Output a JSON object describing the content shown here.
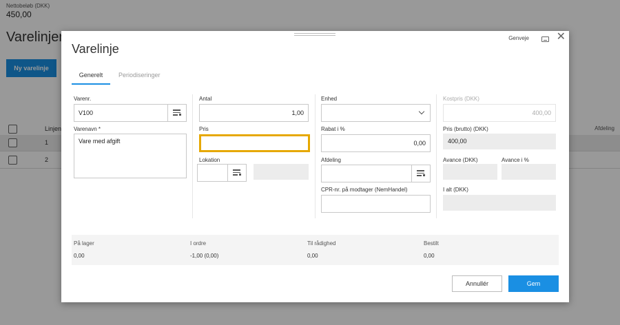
{
  "background": {
    "net_amount_label": "Nettobeløb (DKK)",
    "net_amount_value": "450,00",
    "page_title": "Varelinjer",
    "new_line_button": "Ny varelinje",
    "table": {
      "columns": [
        "Linjen",
        "Afdeling"
      ],
      "rows": [
        {
          "line": "1"
        },
        {
          "line": "2"
        }
      ]
    }
  },
  "modal": {
    "title": "Varelinje",
    "shortcuts_label": "Genveje",
    "tabs": [
      {
        "label": "Generelt",
        "active": true
      },
      {
        "label": "Periodiseringer",
        "active": false
      }
    ],
    "fields": {
      "item_no": {
        "label": "Varenr.",
        "value": "V100"
      },
      "item_name": {
        "label": "Varenavn *",
        "value": "Vare med afgift"
      },
      "quantity": {
        "label": "Antal",
        "value": "1,00"
      },
      "price": {
        "label": "Pris",
        "value": ""
      },
      "location": {
        "label": "Lokation",
        "value": ""
      },
      "unit": {
        "label": "Enhed",
        "value": ""
      },
      "discount": {
        "label": "Rabat i %",
        "value": "0,00"
      },
      "department": {
        "label": "Afdeling",
        "value": ""
      },
      "cpr": {
        "label": "CPR-nr. på modtager (NemHandel)",
        "value": ""
      },
      "cost_price": {
        "label": "Kostpris (DKK)",
        "value": "400,00"
      },
      "gross_price": {
        "label": "Pris (brutto) (DKK)",
        "value": "400,00"
      },
      "markup_dkk": {
        "label": "Avance (DKK)",
        "value": ""
      },
      "markup_pct": {
        "label": "Avance i %",
        "value": ""
      },
      "total": {
        "label": "I alt (DKK)",
        "value": ""
      }
    },
    "stock": [
      {
        "label": "På lager",
        "value": "0,00"
      },
      {
        "label": "I ordre",
        "value": "-1,00 (0,00)"
      },
      {
        "label": "Til rådighed",
        "value": "0,00"
      },
      {
        "label": "Bestilt",
        "value": "0,00"
      }
    ],
    "buttons": {
      "cancel": "Annullér",
      "save": "Gem"
    },
    "colors": {
      "accent": "#1a8fe3",
      "focus": "#e6a800"
    }
  }
}
